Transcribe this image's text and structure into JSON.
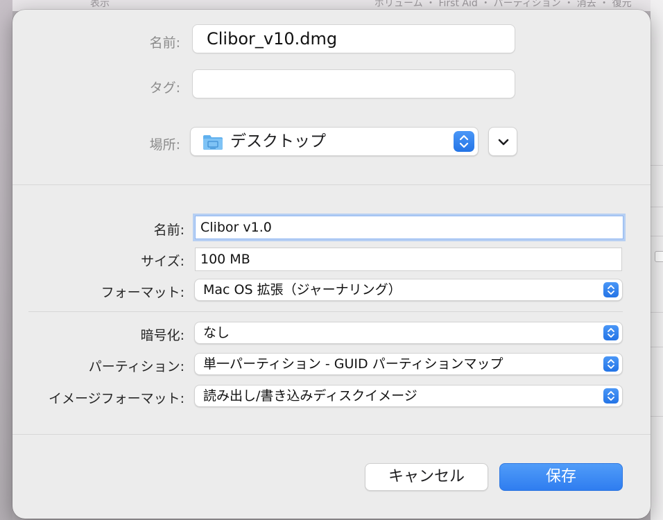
{
  "background": {
    "top_left_text": "表示",
    "top_right_text": "ボリューム  ・ First Aid  ・ パーティション  ・ 消去  ・ 復元"
  },
  "save_section": {
    "name_label": "名前:",
    "name_value": "Clibor_v10.dmg",
    "tags_label": "タグ:",
    "tags_value": "",
    "location_label": "場所:",
    "location_value": "デスクトップ"
  },
  "options_section": {
    "volume_name_label": "名前:",
    "volume_name_value": "Clibor v1.0",
    "size_label": "サイズ:",
    "size_value": "100 MB",
    "format_label": "フォーマット:",
    "format_value": "Mac OS 拡張（ジャーナリング）",
    "encryption_label": "暗号化:",
    "encryption_value": "なし",
    "partition_label": "パーティション:",
    "partition_value": "単一パーティション - GUID パーティションマップ",
    "image_format_label": "イメージフォーマット:",
    "image_format_value": "読み出し/書き込みディスクイメージ"
  },
  "buttons": {
    "cancel": "キャンセル",
    "save": "保存"
  },
  "colors": {
    "accent": "#2f7df0",
    "sheet_bg": "#ececec",
    "focus_ring": "#b6cff3"
  }
}
